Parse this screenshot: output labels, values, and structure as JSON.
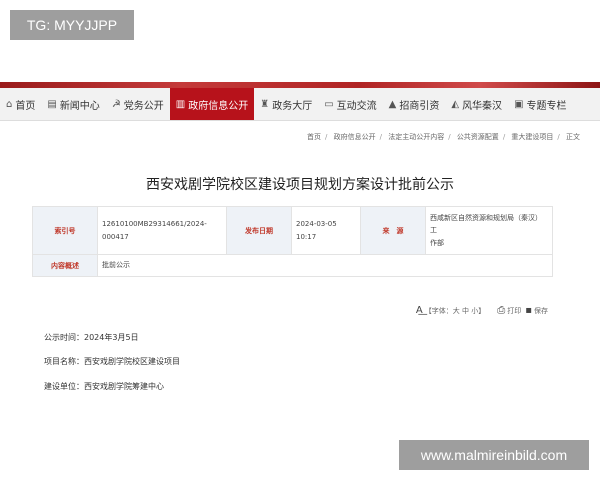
{
  "overlay_top": "TG: MYYJJPP",
  "overlay_bottom": "www.malmireinbild.com",
  "nav": {
    "items": [
      {
        "label": "首页",
        "icon": "home-icon"
      },
      {
        "label": "新闻中心",
        "icon": "news-icon"
      },
      {
        "label": "党务公开",
        "icon": "party-icon"
      },
      {
        "label": "政府信息公开",
        "icon": "book-icon",
        "active": true
      },
      {
        "label": "政务大厅",
        "icon": "hall-icon"
      },
      {
        "label": "互动交流",
        "icon": "chat-icon"
      },
      {
        "label": "招商引资",
        "icon": "chart-icon"
      },
      {
        "label": "风华秦汉",
        "icon": "scenery-icon"
      },
      {
        "label": "专题专栏",
        "icon": "topic-icon"
      }
    ],
    "active_color": "#b7121b"
  },
  "breadcrumb": [
    "首页",
    "政府信息公开",
    "法定主动公开内容",
    "公共资源配置",
    "重大建设项目",
    "正文"
  ],
  "title": "西安戏剧学院校区建设项目规划方案设计批前公示",
  "meta": {
    "index_label": "索引号",
    "index_value_1": "12610100MB29314661/2024-",
    "index_value_2": "000417",
    "date_label": "发布日期",
    "date_value_1": "2024-03-05",
    "date_value_2": "10:17",
    "source_label": "来　源",
    "source_value_1": "西咸新区自然资源和规划局（秦汉）工",
    "source_value_2": "作部",
    "summary_label": "内容概述",
    "summary_value": "批前公示"
  },
  "tools": {
    "font_label": "【字体：大 中 小】",
    "print_label": "打印",
    "save_label": "保存"
  },
  "info": {
    "pub_time": "公示时间：2024年3月5日",
    "project": "项目名称：西安戏剧学院校区建设项目",
    "unit": "建设单位：西安戏剧学院筹建中心"
  }
}
